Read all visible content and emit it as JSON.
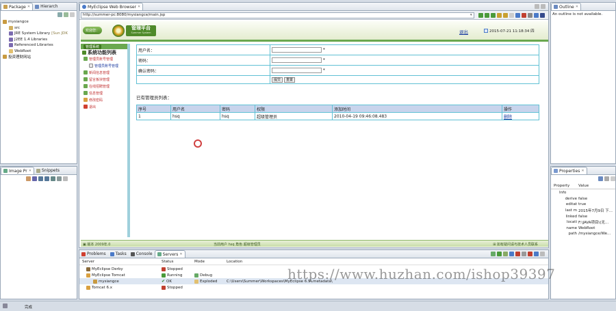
{
  "package_view": {
    "tabs": [
      "Package",
      "Hierarch"
    ],
    "tree": [
      {
        "label": "mysiangce",
        "depth": 0
      },
      {
        "label": "src",
        "depth": 1
      },
      {
        "label": "JRE System Library",
        "suffix": "[Sun JDK",
        "depth": 1
      },
      {
        "label": "J2EE 1.4 Libraries",
        "depth": 1
      },
      {
        "label": "Referenced Libraries",
        "depth": 1
      },
      {
        "label": "WebRoot",
        "depth": 1
      },
      {
        "label": "投资理财网站",
        "depth": 0
      }
    ]
  },
  "image_view": {
    "tabs": [
      "Image Pr",
      "Snippets"
    ]
  },
  "browser": {
    "tab": "MyEclipse Web Browser",
    "url": "http://summer-pc:8080/mysiangce/main.jsp",
    "header": {
      "welcome": "欢迎您：",
      "logo_text": "管理平台",
      "logo_sub": "Summer System",
      "logout": "退出",
      "datetime": "2015-07-21 11:18:34 四"
    },
    "menu": {
      "top_label": "管理系统",
      "title": "系统功能列表",
      "items": [
        {
          "label": "管理员账号管理",
          "depth": 0
        },
        {
          "label": "管理员账号管理",
          "depth": 1
        },
        {
          "label": "新闻信息管理",
          "depth": 0
        },
        {
          "label": "留言板块管理",
          "depth": 0
        },
        {
          "label": "在线招聘管理",
          "depth": 0
        },
        {
          "label": "信息管理",
          "depth": 0
        },
        {
          "label": "修改密码",
          "depth": 0
        },
        {
          "label": "退出",
          "depth": 0
        }
      ]
    },
    "form": {
      "username_label": "用户名：",
      "password_label": "密码：",
      "confirm_label": "确认密码：",
      "required_mark": "*",
      "submit_label": "提交",
      "reset_label": "重置"
    },
    "list_title": "已有管理员列表：",
    "table": {
      "headers": [
        "序号",
        "用户名",
        "密码",
        "权限",
        "添加时间",
        "操作"
      ],
      "rows": [
        [
          "1",
          "hsq",
          "hsq",
          "超级管理员",
          "2010-04-19 09:46:08.483",
          "删除"
        ]
      ]
    },
    "status": {
      "left": "▣ 版本 2009年.0",
      "middle": "当前用户 hsq  角色 超级管理员",
      "right": "⊞ 如有疑问请与技术人员联系"
    }
  },
  "outline": {
    "tab": "Outline",
    "message": "An outline is not available."
  },
  "properties": {
    "tab": "Properties",
    "headers": [
      "Property",
      "Value"
    ],
    "group": "Info",
    "rows": [
      {
        "key": "derive",
        "value": "false"
      },
      {
        "key": "editat",
        "value": "true"
      },
      {
        "key": "last m",
        "value": "2015年7月9日 下..."
      },
      {
        "key": "linked",
        "value": "false"
      },
      {
        "key": "locati",
        "value": "F:\\JAVA项目\\(无..."
      },
      {
        "key": "name",
        "value": "WebRoot"
      },
      {
        "key": "path",
        "value": "/mysiangce/We..."
      }
    ]
  },
  "servers": {
    "tabs": [
      "Problems",
      "Tasks",
      "Console",
      "Servers"
    ],
    "headers": [
      "Server",
      "Status",
      "Mode",
      "Location"
    ],
    "rows": [
      {
        "server": "MyEclipse Derby",
        "status": "Stopped",
        "mode": "",
        "location": "",
        "depth": 0
      },
      {
        "server": "MyEclipse Tomcat",
        "status": "Running",
        "mode": "Debug",
        "location": "",
        "depth": 0
      },
      {
        "server": "mysiangce",
        "status": "OK",
        "mode": "Exploded",
        "location": "C:\\Users\\Summer\\Workspaces\\MyEclipse 6.5\\.metadata\\",
        "depth": 1
      },
      {
        "server": "Tomcat 6.x",
        "status": "Stopped",
        "mode": "",
        "location": "",
        "depth": 0
      }
    ]
  },
  "watermark": "https://www.huzhan.com/ishop39397",
  "statusbar": {
    "text": "完成"
  },
  "colors": {
    "green": "#6aa84f",
    "dark_green": "#3f7a1f",
    "cyan": "#5fc0d4",
    "table_header": "#c8d4ec"
  }
}
